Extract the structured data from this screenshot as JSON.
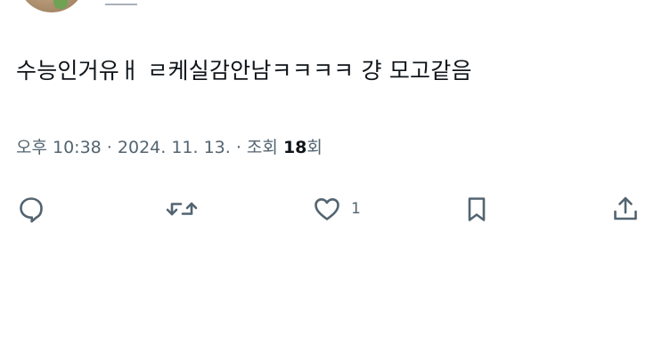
{
  "tweet": {
    "handle_partial": "_",
    "text": "수능인거유ㅐ ㄹ케실감안남ㅋㅋㅋㅋ 걍 모고같음",
    "meta": {
      "time": "오후 10:38",
      "separator": " · ",
      "date": "2024. 11. 13.",
      "views_label": "조회",
      "views_count": "18",
      "views_suffix": "회"
    }
  },
  "actions": {
    "reply": {
      "icon": "reply-bubble-icon"
    },
    "retweet": {
      "icon": "retweet-arrows-icon"
    },
    "like": {
      "icon": "heart-icon",
      "count": "1"
    },
    "bookmark": {
      "icon": "bookmark-icon"
    },
    "share": {
      "icon": "share-upload-icon"
    }
  },
  "colors": {
    "text": "#0f1419",
    "secondary": "#536471",
    "background": "#ffffff"
  }
}
